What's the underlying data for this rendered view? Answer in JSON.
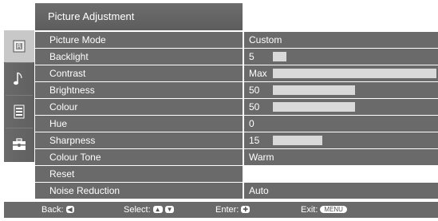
{
  "header": {
    "title": "Picture Adjustment"
  },
  "sidebar": {
    "items": [
      {
        "name": "picture-icon"
      },
      {
        "name": "music-note-icon"
      },
      {
        "name": "sliders-icon"
      },
      {
        "name": "toolbox-icon"
      }
    ]
  },
  "settings": [
    {
      "label": "Picture Mode",
      "value": "Custom"
    },
    {
      "label": "Backlight",
      "value": "5",
      "level": 5,
      "max": 60
    },
    {
      "label": "Contrast",
      "value": "Max",
      "level": 100,
      "max": 100
    },
    {
      "label": "Brightness",
      "value": "50",
      "level": 50,
      "max": 100
    },
    {
      "label": "Colour",
      "value": "50",
      "level": 50,
      "max": 100
    },
    {
      "label": "Hue",
      "value": "0"
    },
    {
      "label": "Sharpness",
      "value": "15",
      "level": 15,
      "max": 50
    },
    {
      "label": "Colour Tone",
      "value": "Warm"
    },
    {
      "label": "Reset",
      "value": ""
    },
    {
      "label": "Noise Reduction",
      "value": "Auto"
    }
  ],
  "footer": {
    "back_label": "Back:",
    "select_label": "Select:",
    "enter_label": "Enter:",
    "exit_label": "Exit:",
    "menu_key": "MENU"
  }
}
